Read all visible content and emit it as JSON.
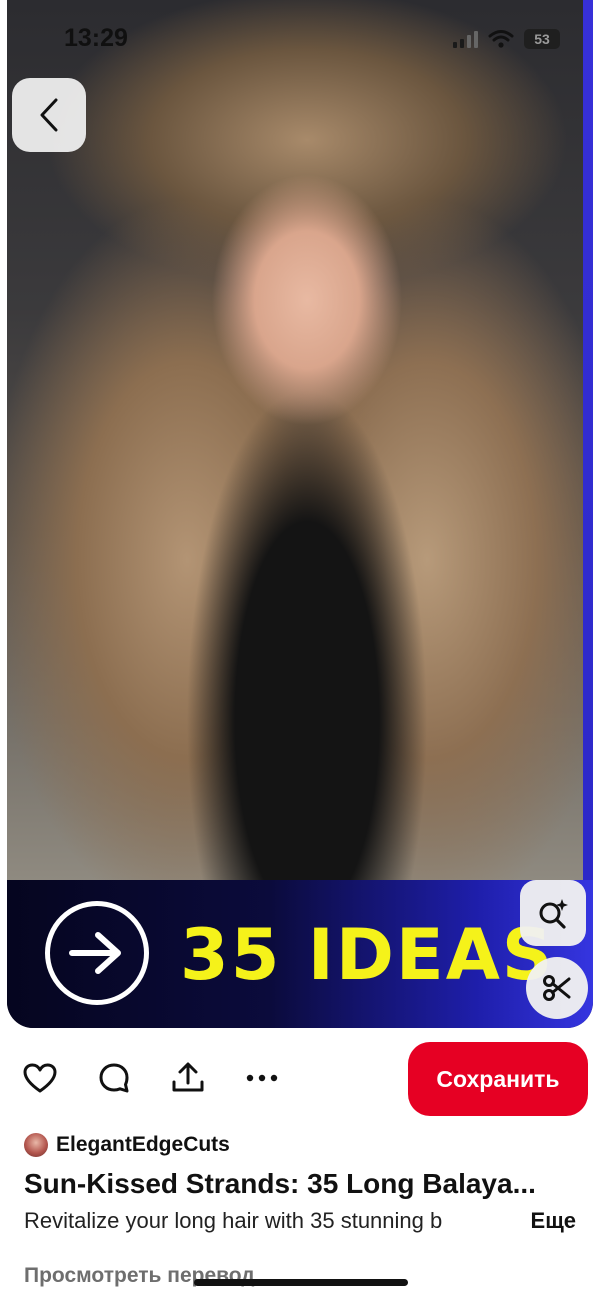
{
  "status_bar": {
    "time": "13:29",
    "battery": "53"
  },
  "pin": {
    "image_subject": "woman-with-long-balayage-hair",
    "banner_text": "35 IDEAS",
    "banner_icon": "arrow-right-circle-icon",
    "colors": {
      "banner_text": "#f5f21a",
      "banner_bg_start": "#05051f",
      "banner_bg_end": "#3535e0"
    }
  },
  "actions": {
    "like_icon": "heart-icon",
    "comment_icon": "comment-icon",
    "share_icon": "share-icon",
    "more_icon": "more-dots-icon",
    "save_label": "Сохранить",
    "save_color": "#e60023"
  },
  "author": {
    "name": "ElegantEdgeCuts"
  },
  "title": "Sun-Kissed Strands: 35 Long Balaya...",
  "description": {
    "text": "Revitalize your long hair with 35 stunning b",
    "more_label": "Еще"
  },
  "translate_label": "Просмотреть перевод"
}
